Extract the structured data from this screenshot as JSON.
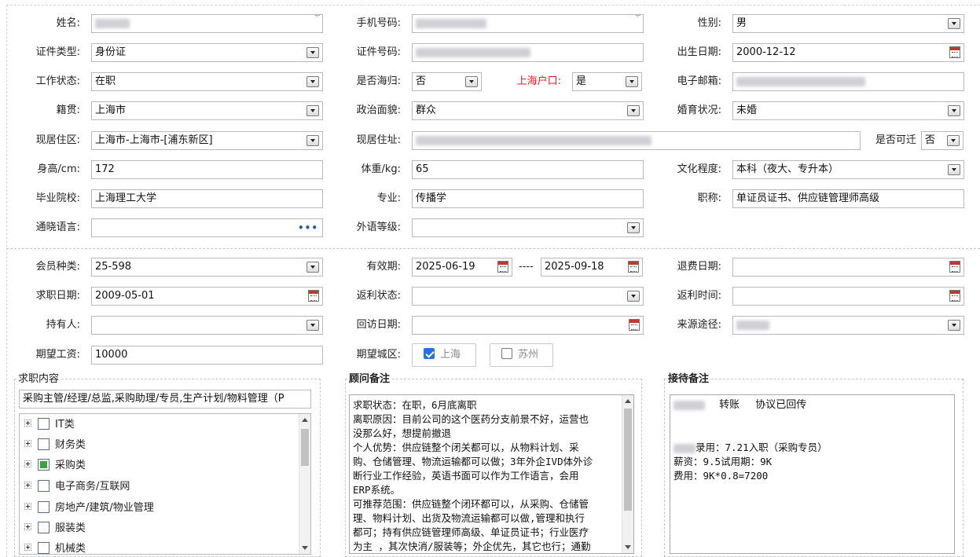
{
  "personal": {
    "name": {
      "label": "姓名:"
    },
    "phone": {
      "label": "手机号码:"
    },
    "gender": {
      "label": "性别:",
      "value": "男"
    },
    "id_type": {
      "label": "证件类型:",
      "value": "身份证"
    },
    "id_number": {
      "label": "证件号码:"
    },
    "birth_date": {
      "label": "出生日期:",
      "value": "2000-12-12"
    },
    "work_status": {
      "label": "工作状态:",
      "value": "在职"
    },
    "returnee": {
      "label": "是否海归:",
      "value": "否"
    },
    "shanghai_hukou": {
      "label": "上海户口:",
      "value": "是"
    },
    "email": {
      "label": "电子邮箱:"
    },
    "native_place": {
      "label": "籍贯:",
      "value": "上海市"
    },
    "political": {
      "label": "政治面貌:",
      "value": "群众"
    },
    "marital": {
      "label": "婚育状况:",
      "value": "未婚"
    },
    "residence_area": {
      "label": "现居住区:",
      "value": "上海市-上海市-[浦东新区]"
    },
    "residence_address": {
      "label": "现居住址:"
    },
    "relocatable": {
      "label": "是否可迁",
      "value": "否"
    },
    "height": {
      "label": "身高/cm:",
      "value": "172"
    },
    "weight": {
      "label": "体重/kg:",
      "value": "65"
    },
    "education": {
      "label": "文化程度:",
      "value": "本科（夜大、专升本）"
    },
    "school": {
      "label": "毕业院校:",
      "value": "上海理工大学"
    },
    "major": {
      "label": "专业:",
      "value": "传播学"
    },
    "title": {
      "label": "职称:",
      "value": "单证员证书、供应链管理师高级"
    },
    "languages": {
      "label": "通晓语言:",
      "value": ""
    },
    "foreign_level": {
      "label": "外语等级:",
      "value": ""
    }
  },
  "membership": {
    "member_type": {
      "label": "会员种类:",
      "value": "25-598"
    },
    "validity": {
      "label": "有效期:",
      "start": "2025-06-19",
      "separator": "----",
      "end": "2025-09-18"
    },
    "refund_date": {
      "label": "退费日期:",
      "value": ""
    },
    "job_date": {
      "label": "求职日期:",
      "value": "2009-05-01"
    },
    "rebate_status": {
      "label": "返利状态:",
      "value": ""
    },
    "rebate_time": {
      "label": "返利时间:",
      "value": ""
    },
    "holder": {
      "label": "持有人:",
      "value": ""
    },
    "visit_date": {
      "label": "回访日期:",
      "value": ""
    },
    "source": {
      "label": "来源途径:"
    },
    "salary": {
      "label": "期望工资:",
      "value": "10000"
    },
    "city": {
      "label": "期望城区:",
      "options": [
        {
          "label": "上海",
          "checked": true
        },
        {
          "label": "苏州",
          "checked": false
        }
      ]
    }
  },
  "job_panel": {
    "title": "求职内容",
    "selected_text": "采购主管/经理/总监,采购助理/专员,生产计划/物料管理（P",
    "tree": [
      {
        "label": "IT类",
        "state": "unchecked"
      },
      {
        "label": "财务类",
        "state": "unchecked"
      },
      {
        "label": "采购类",
        "state": "partial"
      },
      {
        "label": "电子商务/互联网",
        "state": "unchecked"
      },
      {
        "label": "房地产/建筑/物业管理",
        "state": "unchecked"
      },
      {
        "label": "服装类",
        "state": "unchecked"
      },
      {
        "label": "机械类",
        "state": "unchecked"
      }
    ]
  },
  "consultant_panel": {
    "title": "顾问备注",
    "lines": [
      "求职状态：在职，6月底离职",
      "离职原因：目前公司的这个医药分支前景不好，运营也",
      "没那么好，想提前撤退",
      "个人优势：供应链整个闭关都可以，从物料计划、采",
      "购、仓储管理、物流运输都可以做；3年外企IVD体外诊",
      "断行业工作经验，英语书面可以作为工作语言，会用",
      "ERP系统。",
      "可推荐范围：供应链整个闭环都可以，从采购、仓储管",
      "理、物料计划、出货及物流运输都可以做,管理和执行",
      "都可；持有供应链管理师高级、单证员证书；行业医疗",
      "为主 ，其次快消/服装等；外企优先，其它也行；通勤"
    ]
  },
  "reception_panel": {
    "title": "接待备注",
    "line1_a": "转账",
    "line1_b": "协议已回传",
    "line2": "录用：7.21入职（采购专员）",
    "line3": "薪资：9.5试用期：9K",
    "line4": "费用：9K*0.8=7200"
  },
  "colors": {
    "required": "#e2201d",
    "checked": "#1e73e8",
    "tree_partial": "#3aa43a"
  },
  "icons": [
    "dropdown-arrow-icon",
    "calendar-icon",
    "ellipsis-icon",
    "required-asterisk-icon",
    "tree-expand-icon",
    "checkbox-icon"
  ]
}
